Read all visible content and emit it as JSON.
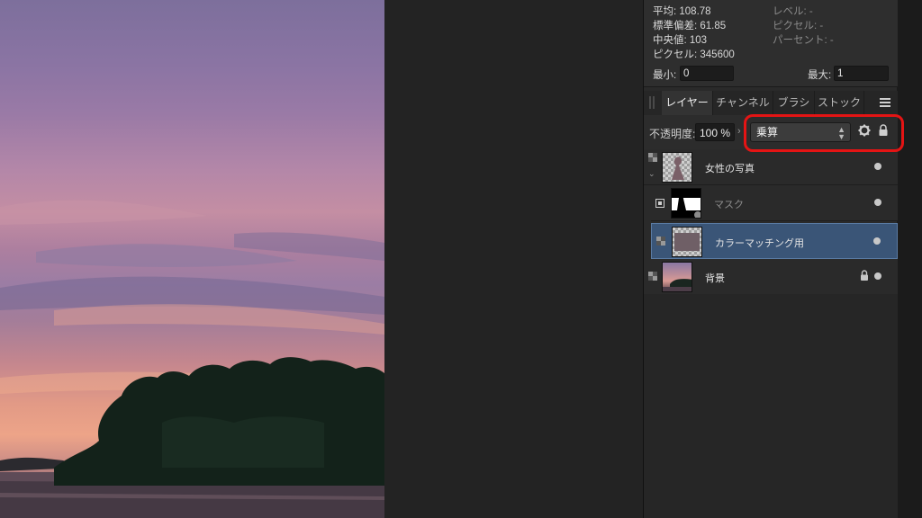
{
  "histogram": {
    "mean_label": "平均: 108.78",
    "std_label": "標準偏差: 61.85",
    "median_label": "中央値: 103",
    "pixels_label": "ピクセル: 345600",
    "level_label": "レベル: -",
    "pixel_label2": "ピクセル: -",
    "percent_label": "パーセント: -",
    "min_label": "最小:",
    "min_value": "0",
    "max_label": "最大:",
    "max_value": "1"
  },
  "tabs": [
    {
      "label": "レイヤー",
      "active": true
    },
    {
      "label": "チャンネル",
      "active": false
    },
    {
      "label": "ブラシ",
      "active": false
    },
    {
      "label": "ストック",
      "active": false
    }
  ],
  "layer_controls": {
    "opacity_label": "不透明度:",
    "opacity_value": "100 %",
    "blend_mode": "乗算"
  },
  "layers": [
    {
      "name": "女性の写真",
      "type": "pixel",
      "selected": false,
      "locked": false
    },
    {
      "name": "マスク",
      "type": "mask",
      "selected": false,
      "locked": false
    },
    {
      "name": "カラーマッチング用",
      "type": "fill",
      "selected": true,
      "locked": false
    },
    {
      "name": "背景",
      "type": "pixel",
      "selected": false,
      "locked": true
    }
  ],
  "colors": {
    "accent_selected": "#3a5577",
    "highlight": "#e41414",
    "panel_bg": "#2a2a2a"
  }
}
